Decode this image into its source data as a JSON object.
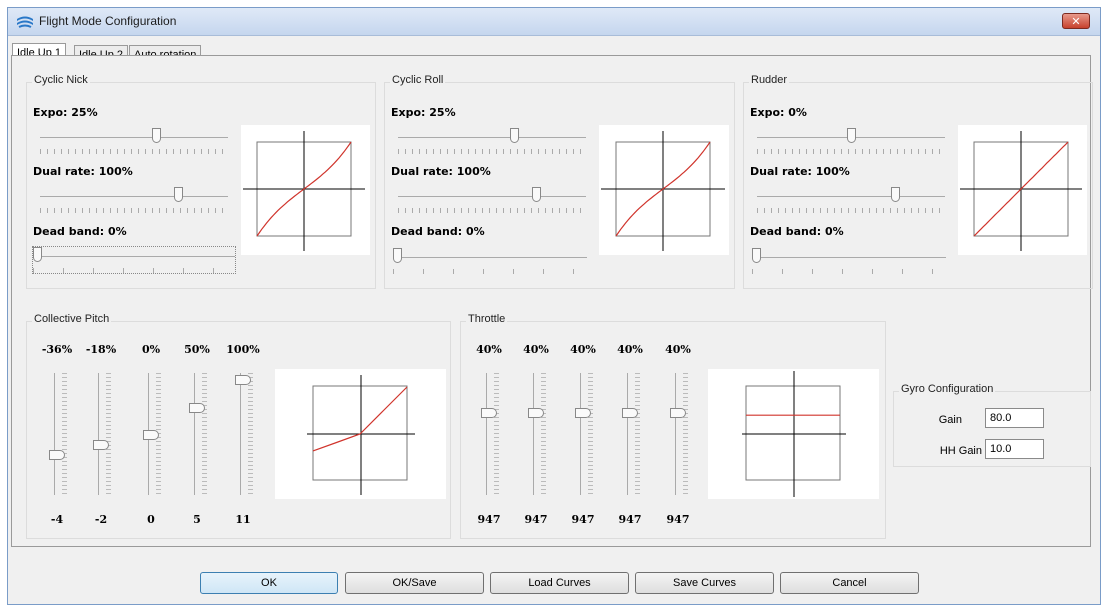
{
  "window": {
    "title": "Flight Mode Configuration",
    "close_glyph": "✕"
  },
  "tabs": [
    {
      "label": "Idle Up 1",
      "active": true
    },
    {
      "label": "Idle Up 2",
      "active": false
    },
    {
      "label": "Auto rotation",
      "active": false
    }
  ],
  "cyclic_nick": {
    "title": "Cyclic Nick",
    "expo_label": "Expo: 25%",
    "expo": 25,
    "dual_rate_label": "Dual rate: 100%",
    "dual_rate": 100,
    "dead_band_label": "Dead band: 0%",
    "dead_band": 0
  },
  "cyclic_roll": {
    "title": "Cyclic Roll",
    "expo_label": "Expo: 25%",
    "expo": 25,
    "dual_rate_label": "Dual rate: 100%",
    "dual_rate": 100,
    "dead_band_label": "Dead band: 0%",
    "dead_band": 0
  },
  "rudder": {
    "title": "Rudder",
    "expo_label": "Expo: 0%",
    "expo": 0,
    "dual_rate_label": "Dual rate: 100%",
    "dual_rate": 100,
    "dead_band_label": "Dead band: 0%",
    "dead_band": 0
  },
  "collective_pitch": {
    "title": "Collective Pitch",
    "points": [
      {
        "percent": "-36%",
        "value": "-4",
        "level": -36
      },
      {
        "percent": "-18%",
        "value": "-2",
        "level": -18
      },
      {
        "percent": "0%",
        "value": "0",
        "level": 0
      },
      {
        "percent": "50%",
        "value": "5",
        "level": 50
      },
      {
        "percent": "100%",
        "value": "11",
        "level": 100
      }
    ]
  },
  "throttle": {
    "title": "Throttle",
    "points": [
      {
        "percent": "40%",
        "value": "947",
        "level": 40
      },
      {
        "percent": "40%",
        "value": "947",
        "level": 40
      },
      {
        "percent": "40%",
        "value": "947",
        "level": 40
      },
      {
        "percent": "40%",
        "value": "947",
        "level": 40
      },
      {
        "percent": "40%",
        "value": "947",
        "level": 40
      }
    ]
  },
  "gyro": {
    "title": "Gyro Configuration",
    "gain_label": "Gain",
    "gain": "80.0",
    "hh_gain_label": "HH Gain",
    "hh_gain": "10.0"
  },
  "buttons": {
    "ok": "OK",
    "ok_save": "OK/Save",
    "load_curves": "Load Curves",
    "save_curves": "Save Curves",
    "cancel": "Cancel"
  },
  "colors": {
    "curve": "#d0342c",
    "axis": "#000000",
    "accent": "#3c7fb1"
  }
}
